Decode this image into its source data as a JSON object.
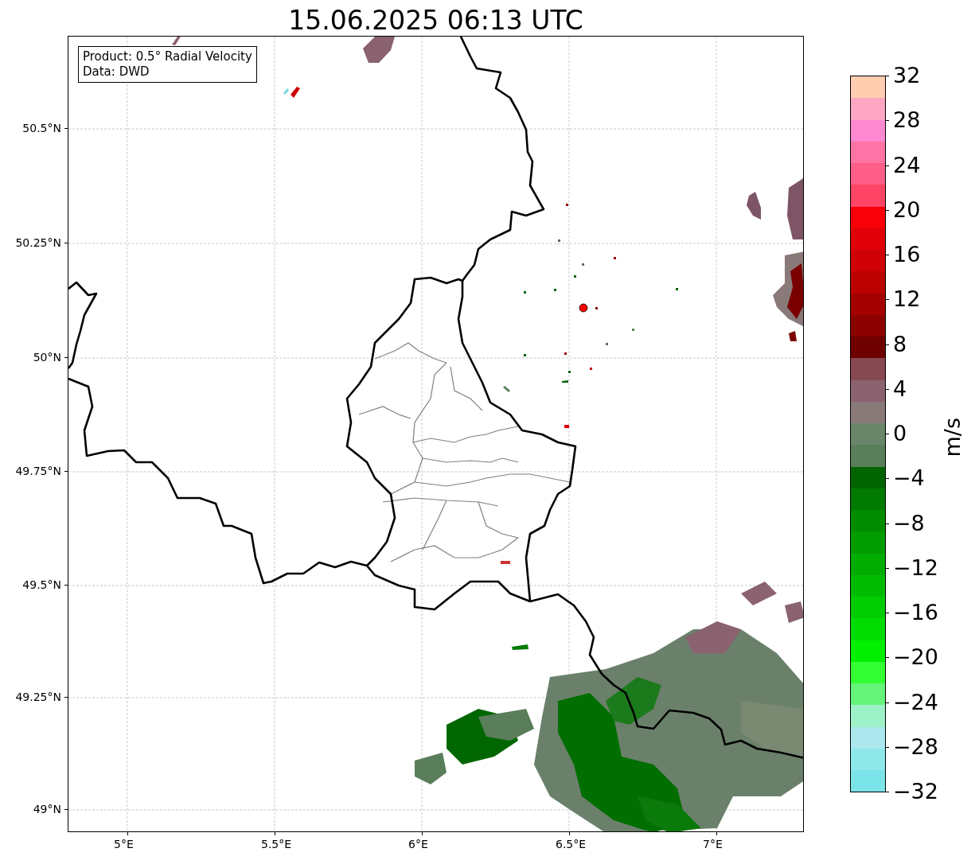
{
  "title": "15.06.2025 06:13 UTC",
  "info_box": {
    "lines": [
      "Product: 0.5° Radial Velocity",
      "Data: DWD"
    ]
  },
  "x_ticks": [
    "5°E",
    "5.5°E",
    "6°E",
    "6.5°E",
    "7°E"
  ],
  "y_ticks": [
    "50.5°N",
    "50.25°N",
    "50°N",
    "49.75°N",
    "49.5°N",
    "49.25°N",
    "49°N"
  ],
  "colorbar": {
    "label": "m/s",
    "ticks": [
      "32",
      "28",
      "24",
      "20",
      "16",
      "12",
      "8",
      "4",
      "0",
      "−4",
      "−8",
      "−12",
      "−16",
      "−20",
      "−24",
      "−28",
      "−32"
    ],
    "bands": [
      {
        "color": "#ffcdb0"
      },
      {
        "color": "#ffa6c4"
      },
      {
        "color": "#ff88d0"
      },
      {
        "color": "#ff74a4"
      },
      {
        "color": "#ff5e88"
      },
      {
        "color": "#ff4466"
      },
      {
        "color": "#f70008"
      },
      {
        "color": "#e00008"
      },
      {
        "color": "#d00008"
      },
      {
        "color": "#bb0000"
      },
      {
        "color": "#a40000"
      },
      {
        "color": "#8c0000"
      },
      {
        "color": "#6e0000"
      },
      {
        "color": "#864851"
      },
      {
        "color": "#8a6270"
      },
      {
        "color": "#8a7979"
      },
      {
        "color": "#6a866a"
      },
      {
        "color": "#5a7d5a"
      },
      {
        "color": "#006400"
      },
      {
        "color": "#007a00"
      },
      {
        "color": "#008c00"
      },
      {
        "color": "#009c00"
      },
      {
        "color": "#00ac00"
      },
      {
        "color": "#00bc00"
      },
      {
        "color": "#00cc00"
      },
      {
        "color": "#00dc00"
      },
      {
        "color": "#00f000"
      },
      {
        "color": "#33ff33"
      },
      {
        "color": "#66f47a"
      },
      {
        "color": "#9ef2c8"
      },
      {
        "color": "#ace8ee"
      },
      {
        "color": "#8ee8ea"
      },
      {
        "color": "#7ae4e8"
      }
    ]
  }
}
